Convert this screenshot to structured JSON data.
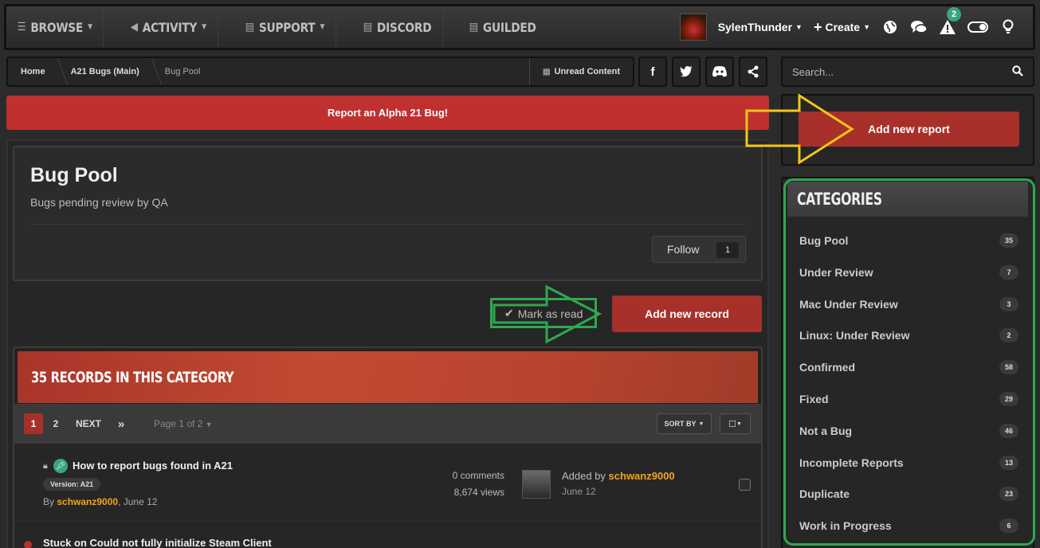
{
  "nav": {
    "items": [
      {
        "label": "BROWSE",
        "icon": "list-icon",
        "has_caret": true
      },
      {
        "label": "ACTIVITY",
        "icon": "megaphone-icon",
        "has_caret": true
      },
      {
        "label": "SUPPORT",
        "icon": "document-icon",
        "has_caret": true
      },
      {
        "label": "DISCORD",
        "icon": "document-icon",
        "has_caret": false
      },
      {
        "label": "GUILDED",
        "icon": "document-icon",
        "has_caret": false
      }
    ],
    "user_name": "SylenThunder",
    "create_label": "Create",
    "notification_count": "2"
  },
  "breadcrumb": {
    "items": [
      "Home",
      "A21 Bugs (Main)",
      "Bug Pool"
    ],
    "unread_label": "Unread Content"
  },
  "banner": {
    "text": "Report an Alpha 21 Bug!"
  },
  "header": {
    "title": "Bug Pool",
    "description": "Bugs pending review by QA",
    "follow_label": "Follow",
    "follow_count": "1"
  },
  "actions": {
    "mark_read": "Mark as read",
    "add_record": "Add new record"
  },
  "records": {
    "heading": "35 RECORDS IN THIS CATEGORY",
    "pages": [
      "1",
      "2"
    ],
    "next_label": "NEXT",
    "page_of": "Page 1 of 2",
    "sort_label": "SORT BY",
    "list": [
      {
        "title": "How to report bugs found in A21",
        "version": "Version: A21",
        "by_prefix": "By ",
        "author": "schwanz9000",
        "date": ", June 12",
        "comments": "0 comments",
        "views": "8,674 views",
        "added_prefix": "Added by ",
        "added_by": "schwanz9000",
        "added_date": "June 12"
      },
      {
        "title": "Stuck on Could not fully initialize Steam Client"
      }
    ]
  },
  "sidebar": {
    "search_placeholder": "Search...",
    "add_report": "Add new report",
    "categories_heading": "CATEGORIES",
    "categories": [
      {
        "name": "Bug Pool",
        "count": "35"
      },
      {
        "name": "Under Review",
        "count": "7"
      },
      {
        "name": "Mac Under Review",
        "count": "3"
      },
      {
        "name": "Linux: Under Review",
        "count": "2"
      },
      {
        "name": "Confirmed",
        "count": "58"
      },
      {
        "name": "Fixed",
        "count": "29"
      },
      {
        "name": "Not a Bug",
        "count": "46"
      },
      {
        "name": "Incomplete Reports",
        "count": "13"
      },
      {
        "name": "Duplicate",
        "count": "23"
      },
      {
        "name": "Work in Progress",
        "count": "6"
      }
    ]
  },
  "colors": {
    "accent_red": "#a8302a",
    "banner_red": "#c0302f",
    "author_orange": "#f3a41c",
    "annotation_green": "#2fa84f",
    "annotation_yellow": "#f5c518"
  }
}
